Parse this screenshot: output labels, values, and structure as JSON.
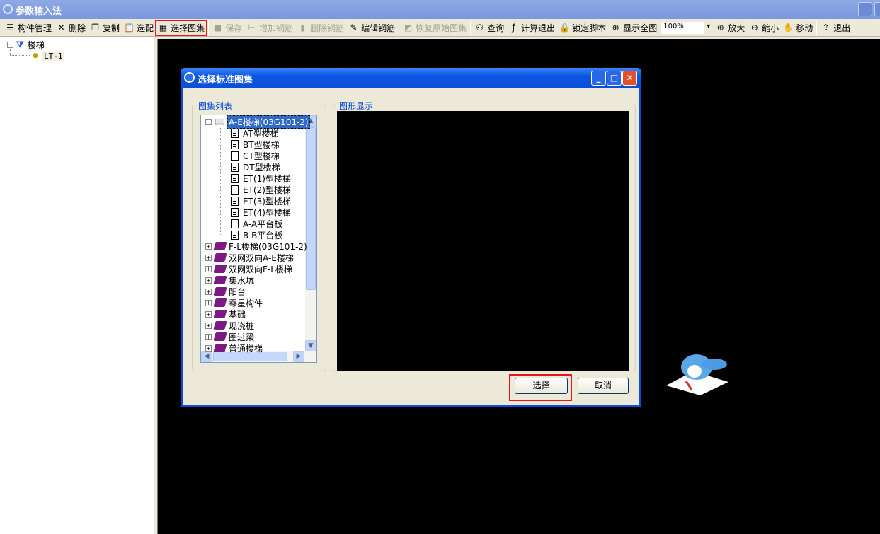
{
  "window": {
    "title": "参数输入法"
  },
  "toolbar": {
    "items": [
      {
        "label": "构件管理",
        "icon": "component-manage-icon",
        "enabled": true
      },
      {
        "label": "删除",
        "icon": "delete-x-icon",
        "enabled": true
      },
      {
        "label": "复制",
        "icon": "copy-icon",
        "enabled": true
      },
      {
        "label": "选配",
        "icon": "clipboard-icon",
        "enabled": true
      },
      {
        "label": "选择图集",
        "icon": "xyz-select-icon",
        "enabled": true,
        "highlighted": true
      },
      {
        "label": "保存",
        "icon": "save-icon",
        "enabled": false
      },
      {
        "label": "增加钢筋",
        "icon": "add-rebar-icon",
        "enabled": false
      },
      {
        "label": "删除钢筋",
        "icon": "delete-rebar-icon",
        "enabled": false
      },
      {
        "label": "编辑钢筋",
        "icon": "edit-rebar-icon",
        "enabled": true
      },
      {
        "label": "恢复原始图集",
        "icon": "restore-icon",
        "enabled": false
      },
      {
        "label": "查询",
        "icon": "binoculars-icon",
        "enabled": true
      },
      {
        "label": "计算退出",
        "icon": "fx-icon",
        "enabled": true
      },
      {
        "label": "锁定脚本",
        "icon": "lock-icon",
        "enabled": true
      },
      {
        "label": "显示全图",
        "icon": "fit-all-icon",
        "enabled": true
      }
    ],
    "zoom_value": "100%",
    "items2": [
      {
        "label": "放大",
        "icon": "zoom-in-icon"
      },
      {
        "label": "缩小",
        "icon": "zoom-out-icon"
      },
      {
        "label": "移动",
        "icon": "hand-move-icon"
      },
      {
        "label": "退出",
        "icon": "exit-icon"
      }
    ]
  },
  "left_tree": {
    "root": "楼梯",
    "child": "LT-1"
  },
  "dialog": {
    "title": "选择标准图集",
    "list_group": "图集列表",
    "preview_group": "图形显示",
    "tree": {
      "expanded": {
        "label": "A-E楼梯(03G101-2)",
        "children": [
          "AT型楼梯",
          "BT型楼梯",
          "CT型楼梯",
          "DT型楼梯",
          "ET(1)型楼梯",
          "ET(2)型楼梯",
          "ET(3)型楼梯",
          "ET(4)型楼梯",
          "A-A平台板",
          "B-B平台板"
        ]
      },
      "collapsed": [
        "F-L楼梯(03G101-2)",
        "双网双向A-E楼梯",
        "双网双向F-L楼梯",
        "集水坑",
        "阳台",
        "零星构件",
        "基础",
        "现浇桩",
        "圈过梁",
        "普通楼梯"
      ]
    },
    "select_button": "选择",
    "cancel_button": "取消"
  },
  "colors": {
    "highlight": "#e8141c",
    "dialog_title": "#0b55e3",
    "selection": "#316ac5",
    "book": "#7b1b82"
  }
}
